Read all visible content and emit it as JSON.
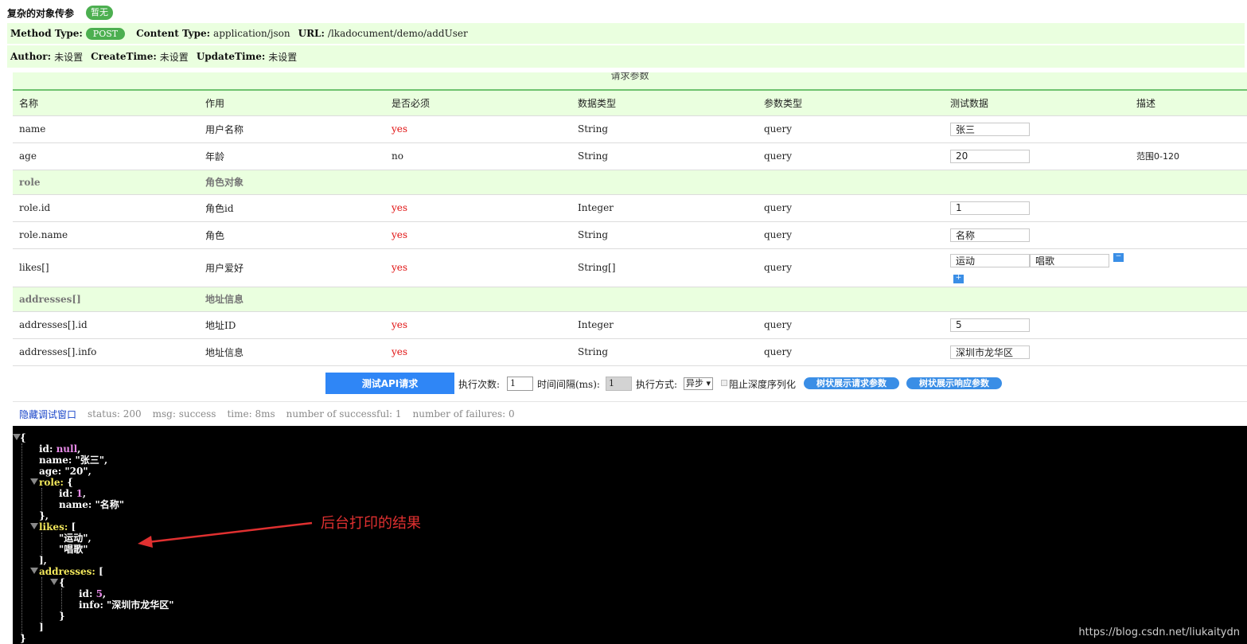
{
  "api": {
    "title": "复杂的对象传参",
    "badge": "暂无",
    "method_label": "Method Type:",
    "method": "POST",
    "content_type_label": "Content Type:",
    "content_type": "application/json",
    "url_label": "URL:",
    "url": "/lkadocument/demo/addUser",
    "author_label": "Author:",
    "author": "未设置",
    "create_time_label": "CreateTime:",
    "create_time": "未设置",
    "update_time_label": "UpdateTime:",
    "update_time": "未设置"
  },
  "section_title": "请求参数",
  "table": {
    "headers": [
      "名称",
      "作用",
      "是否必须",
      "数据类型",
      "参数类型",
      "测试数据",
      "描述"
    ],
    "rows": [
      {
        "name": "name",
        "desc": "用户名称",
        "required": "yes",
        "type": "String",
        "param": "query",
        "test": "张三",
        "note": ""
      },
      {
        "name": "age",
        "desc": "年龄",
        "required": "no",
        "type": "String",
        "param": "query",
        "test": "20",
        "note": "范围0-120"
      },
      {
        "name": "role",
        "desc": "角色对象"
      },
      {
        "name": "role.id",
        "desc": "角色id",
        "required": "yes",
        "type": "Integer",
        "param": "query",
        "test": "1",
        "note": ""
      },
      {
        "name": "role.name",
        "desc": "角色",
        "required": "yes",
        "type": "String",
        "param": "query",
        "test": "名称",
        "note": ""
      },
      {
        "name": "likes[]",
        "desc": "用户爱好",
        "required": "yes",
        "type": "String[]",
        "param": "query",
        "test": "运动",
        "test2": "唱歌",
        "note": ""
      },
      {
        "name": "addresses[]",
        "desc": "地址信息"
      },
      {
        "name": "addresses[].id",
        "desc": "地址ID",
        "required": "yes",
        "type": "Integer",
        "param": "query",
        "test": "5",
        "note": ""
      },
      {
        "name": "addresses[].info",
        "desc": "地址信息",
        "required": "yes",
        "type": "String",
        "param": "query",
        "test": "深圳市龙华区",
        "note": ""
      }
    ]
  },
  "actions": {
    "run_label": "测试API请求",
    "count_label": "执行次数:",
    "count_value": "1",
    "interval_label": "时间间隔(ms):",
    "interval_value": "1",
    "mode_label": "执行方式:",
    "mode_value": "异步 ▾",
    "no_deep_label": "阻止深度序列化",
    "tree_req_label": "树状展示请求参数",
    "tree_resp_label": "树状展示响应参数"
  },
  "status": {
    "toggle_label": "隐藏调试窗口",
    "status": "status: 200",
    "msg": "msg: success",
    "time": "time: 8ms",
    "successful": "number of successful: 1",
    "failures": "number of failures: 0"
  },
  "console": {
    "open_brace": "{",
    "id_line_key": "id: ",
    "id_line_val": "null",
    "name_line": "name: \"张三\",",
    "age_line": "age: \"20\",",
    "role_key": "role:",
    "role_brace": " {",
    "role_id_key": "id: ",
    "role_id_val": "1",
    "role_name": "name: \"名称\"",
    "role_close": "},",
    "likes_key": "likes:",
    "likes_bracket": " [",
    "likes_1": "\"运动\",",
    "likes_2": "\"唱歌\"",
    "likes_close": "],",
    "addr_key": "addresses:",
    "addr_bracket": " [",
    "addr_obj_open": "{",
    "addr_id_key": "id: ",
    "addr_id_val": "5",
    "addr_info": "info: \"深圳市龙华区\"",
    "addr_obj_close": "}",
    "addr_close": "]",
    "close_brace": "}",
    "annotation": "后台打印的结果",
    "watermark": "https://blog.csdn.net/liukaitydn"
  },
  "colors": {
    "light_green": "#eaffdf",
    "badge_green": "#4caf50",
    "button_blue": "#2f86f6",
    "required_red": "#e01010",
    "annotation_red": "#e03030"
  }
}
